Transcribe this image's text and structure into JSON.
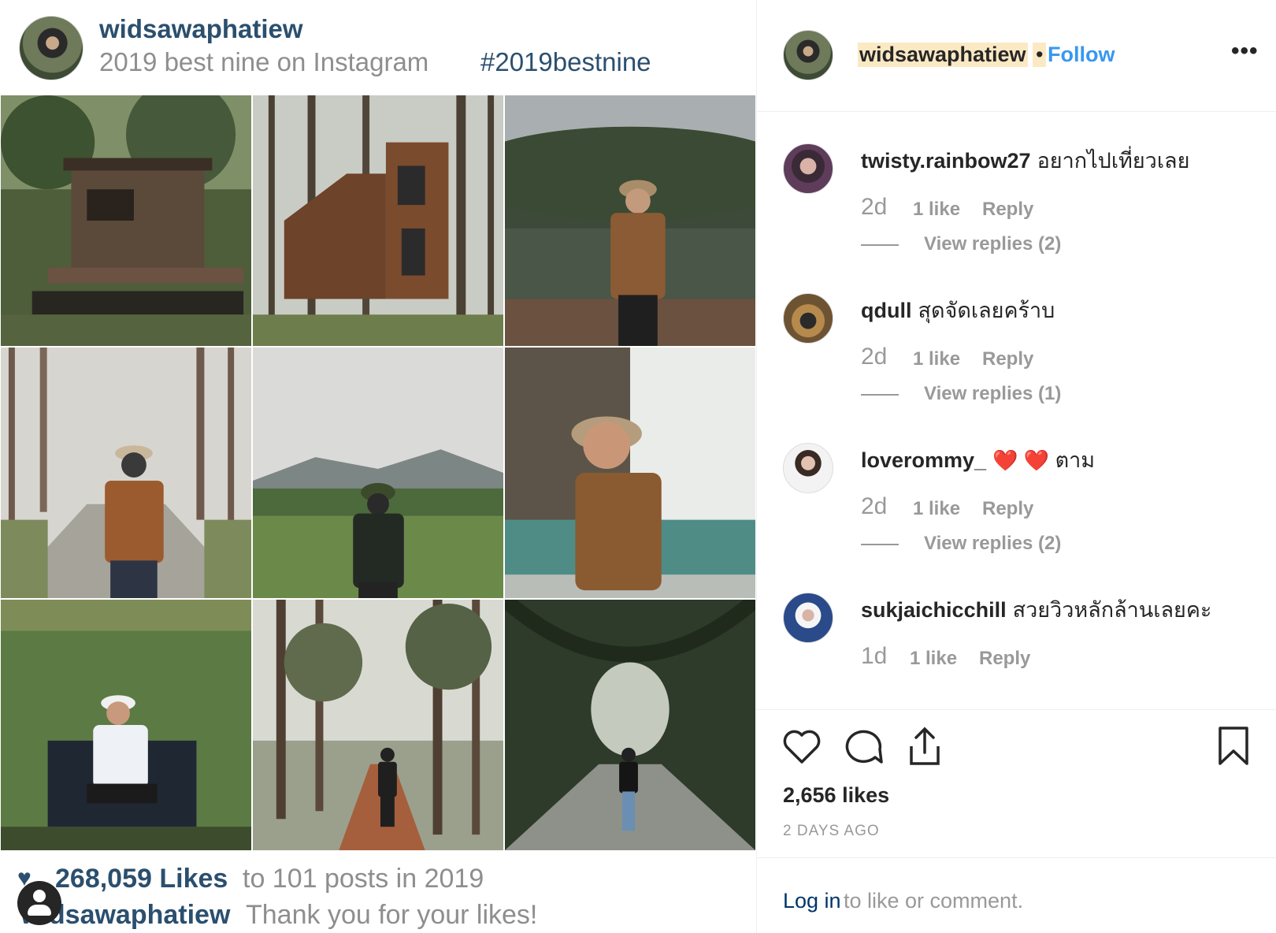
{
  "best_nine": {
    "username": "widsawaphatiew",
    "subtitle": "2019 best nine on Instagram",
    "hashtag": "#2019bestnine",
    "likes_count": "268,059 Likes",
    "likes_text": "to 101 posts in 2019",
    "footer_user": "widsawaphatiew",
    "thanks": "Thank you for your likes!"
  },
  "header": {
    "username": "widsawaphatiew",
    "dot": "•",
    "follow": "Follow",
    "more": "•••"
  },
  "comments": [
    {
      "user": "twisty.rainbow27",
      "text": "อยากไปเที่ยวเลย",
      "time": "2d",
      "likes": "1 like",
      "reply": "Reply",
      "view_replies": "View replies (2)"
    },
    {
      "user": "qdull",
      "text": "สุดจัดเลยคร้าบ",
      "time": "2d",
      "likes": "1 like",
      "reply": "Reply",
      "view_replies": "View replies (1)"
    },
    {
      "user": "loverommy_",
      "text_before": "",
      "hearts": "❤️ ❤️",
      "text": "ตาม",
      "time": "2d",
      "likes": "1 like",
      "reply": "Reply",
      "view_replies": "View replies (2)"
    },
    {
      "user": "sukjaichicchill",
      "text": "สวยวิวหลักล้านเลยคะ",
      "time": "1d",
      "likes": "1 like",
      "reply": "Reply"
    }
  ],
  "post": {
    "likes": "2,656 likes",
    "date": "2 DAYS AGO",
    "login_link": "Log in",
    "login_rest": "to like or comment."
  },
  "icons": [
    "heart-icon",
    "comment-icon",
    "share-icon",
    "bookmark-icon",
    "more-icon"
  ]
}
